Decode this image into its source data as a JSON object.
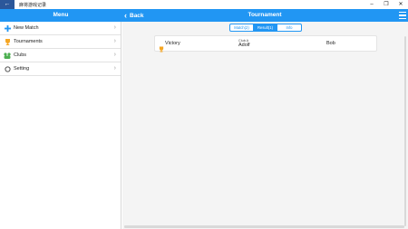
{
  "window": {
    "back_glyph": "←",
    "title": "麻将游戏记录",
    "controls": [
      "–",
      "❐",
      "✕"
    ]
  },
  "header": {
    "menu_title": "Menu",
    "back_label": "Back",
    "page_title": "Tournament"
  },
  "sidebar": {
    "items": [
      {
        "label": "New Match",
        "icon": "plus-icon"
      },
      {
        "label": "Tournaments",
        "icon": "trophy-icon"
      },
      {
        "label": "Clubs",
        "icon": "clubs-icon"
      },
      {
        "label": "Setting",
        "icon": "settings-circle-icon"
      }
    ]
  },
  "tabs": [
    {
      "label": "Match(2)",
      "active": false
    },
    {
      "label": "Result(1)",
      "active": true
    },
    {
      "label": "Info",
      "active": false
    }
  ],
  "results": [
    {
      "result": "Victory",
      "club": "Club A",
      "player1": "Adolf",
      "player2": "Bob"
    }
  ],
  "colors": {
    "accent": "#2196f3",
    "window_back": "#2b579a",
    "trophy": "#f5a623",
    "clubs": "#4caf50"
  }
}
